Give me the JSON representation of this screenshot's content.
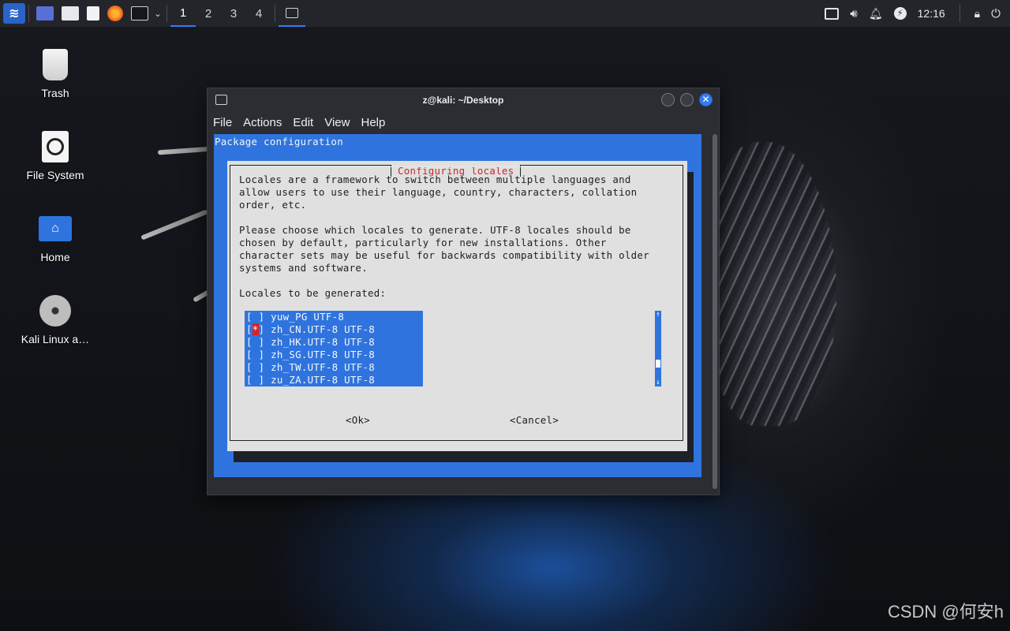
{
  "panel": {
    "workspaces": [
      "1",
      "2",
      "3",
      "4"
    ],
    "active_workspace": "1",
    "clock": "12:16",
    "icons": [
      "kali-menu-icon",
      "desktop-icon",
      "file-manager-icon",
      "text-editor-icon",
      "firefox-icon",
      "terminal-icon",
      "chevron-down-icon",
      "terminal-task-icon",
      "screen-icon",
      "volume-icon",
      "bell-icon",
      "power-manager-icon",
      "lock-icon",
      "logout-icon"
    ]
  },
  "desktop": {
    "icons": [
      {
        "label": "Trash",
        "icon": "trash-icon"
      },
      {
        "label": "File System",
        "icon": "drive-icon"
      },
      {
        "label": "Home",
        "icon": "home-folder-icon"
      },
      {
        "label": "Kali Linux a…",
        "icon": "disc-icon"
      }
    ]
  },
  "window": {
    "title": "z@kali: ~/Desktop",
    "menu": [
      "File",
      "Actions",
      "Edit",
      "View",
      "Help"
    ]
  },
  "terminal": {
    "package_title": "Package configuration",
    "dialog_title": "Configuring locales",
    "text": "Locales are a framework to switch between multiple languages and\nallow users to use their language, country, characters, collation\norder, etc.\n\nPlease choose which locales to generate. UTF-8 locales should be\nchosen by default, particularly for new installations. Other\ncharacter sets may be useful for backwards compatibility with older\nsystems and software.\n\nLocales to be generated:",
    "locales": [
      {
        "mark": " ",
        "name": "yuw_PG UTF-8"
      },
      {
        "mark": "*",
        "name": "zh_CN.UTF-8 UTF-8"
      },
      {
        "mark": " ",
        "name": "zh_HK.UTF-8 UTF-8"
      },
      {
        "mark": " ",
        "name": "zh_SG.UTF-8 UTF-8"
      },
      {
        "mark": " ",
        "name": "zh_TW.UTF-8 UTF-8"
      },
      {
        "mark": " ",
        "name": "zu_ZA.UTF-8 UTF-8"
      }
    ],
    "ok_label": "<Ok>",
    "cancel_label": "<Cancel>"
  },
  "colors": {
    "accent": "#367bf0",
    "dialog_bg": "#e0e0e0",
    "title_red": "#c62a2a"
  },
  "watermark": "CSDN @何安h"
}
